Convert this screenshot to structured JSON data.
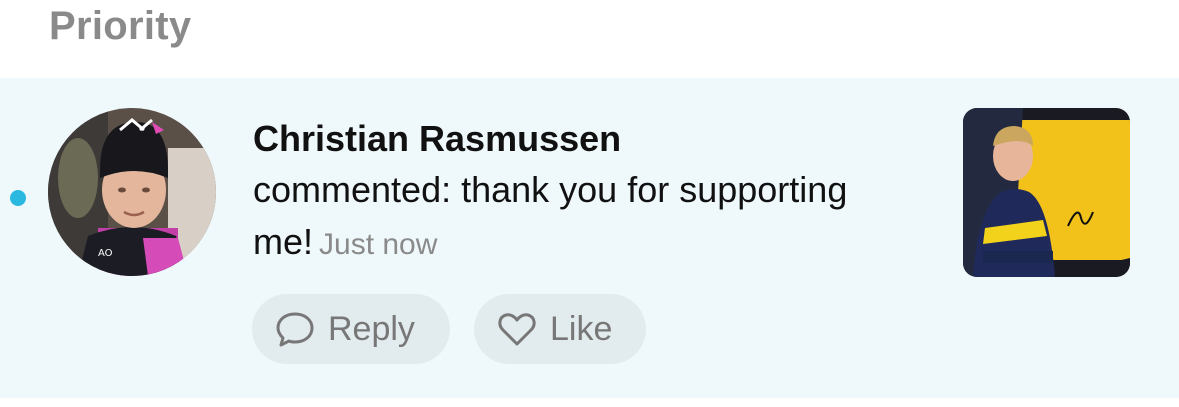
{
  "section": {
    "title": "Priority"
  },
  "notification": {
    "unread": true,
    "unread_color": "#2bb8e0",
    "author": "Christian Rasmussen",
    "text": "commented: thank you for supporting me!",
    "timestamp": "Just now",
    "avatar": "avatar-photo-racing-driver",
    "thumbnail": "signed-photo-card",
    "actions": {
      "reply_label": "Reply",
      "like_label": "Like"
    }
  },
  "colors": {
    "background": "#ffffff",
    "highlight": "#eff8fb",
    "button": "#e2ebee",
    "muted_text": "#8a8a8a"
  }
}
